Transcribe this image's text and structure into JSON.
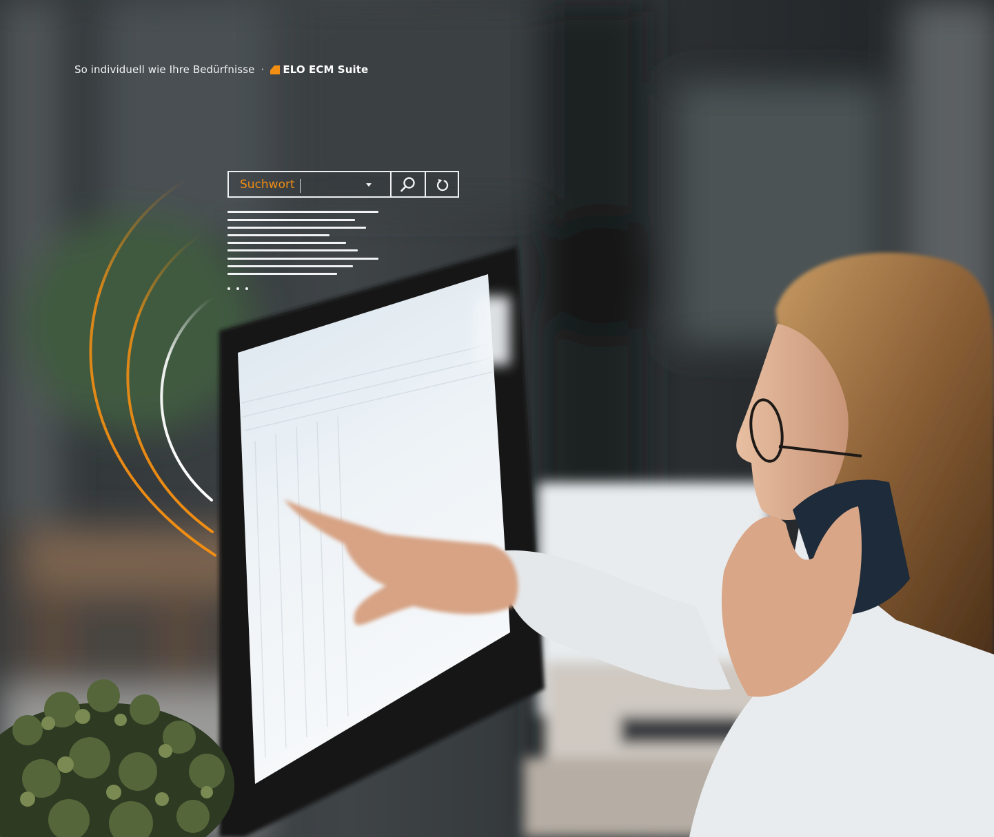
{
  "tagline": {
    "text": "So individuell wie Ihre Bedürfnisse",
    "separator": "·",
    "brand": "ELO ECM Suite"
  },
  "search": {
    "value": "Suchwort",
    "placeholder": "Suchwort",
    "dropdown_icon": "chevron-down-icon",
    "search_icon": "magnifier-icon",
    "reset_icon": "refresh-icon"
  },
  "results": {
    "line_count": 9,
    "more_indicator": "..."
  },
  "colors": {
    "accent": "#F28E12",
    "ui_line": "#F2F3F4"
  }
}
